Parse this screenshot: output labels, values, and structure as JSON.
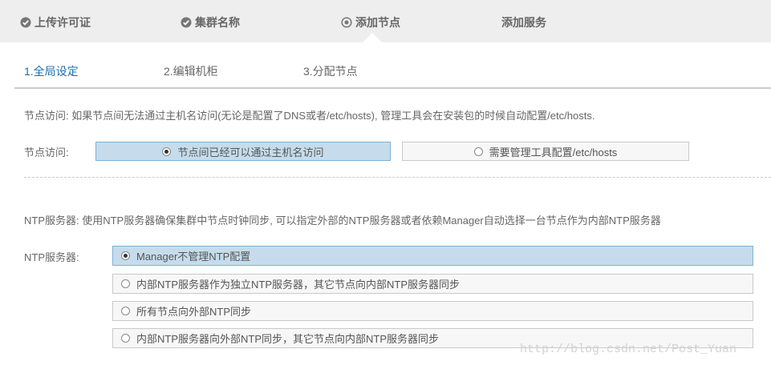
{
  "wizard": {
    "steps": [
      {
        "label": "上传许可证",
        "icon": "check-circle-icon"
      },
      {
        "label": "集群名称",
        "icon": "check-circle-icon"
      },
      {
        "label": "添加节点",
        "icon": "dot-circle-icon"
      },
      {
        "label": "添加服务",
        "icon": ""
      }
    ]
  },
  "subtabs": [
    "1.全局设定",
    "2.编辑机柜",
    "3.分配节点"
  ],
  "node_access": {
    "description": "节点访问: 如果节点间无法通过主机名访问(无论是配置了DNS或者/etc/hosts), 管理工具会在安装包的时候自动配置/etc/hosts.",
    "label": "节点访问:",
    "options": [
      {
        "label": "节点间已经可以通过主机名访问",
        "selected": true
      },
      {
        "label": "需要管理工具配置/etc/hosts",
        "selected": false
      }
    ]
  },
  "ntp": {
    "description": "NTP服务器: 使用NTP服务器确保集群中节点时钟同步, 可以指定外部的NTP服务器或者依赖Manager自动选择一台节点作为内部NTP服务器",
    "label": "NTP服务器:",
    "options": [
      {
        "label": "Manager不管理NTP配置",
        "selected": true
      },
      {
        "label": "内部NTP服务器作为独立NTP服务器，其它节点向内部NTP服务器同步",
        "selected": false
      },
      {
        "label": "所有节点向外部NTP同步",
        "selected": false
      },
      {
        "label": "内部NTP服务器向外部NTP同步，其它节点向内部NTP服务器同步",
        "selected": false
      }
    ]
  },
  "watermark": "http://blog.csdn.net/Post_Yuan",
  "colors": {
    "selected_bg": "#c6dcec",
    "active_tab": "#1a6fb0",
    "wizard_bg": "#eeeeee"
  }
}
